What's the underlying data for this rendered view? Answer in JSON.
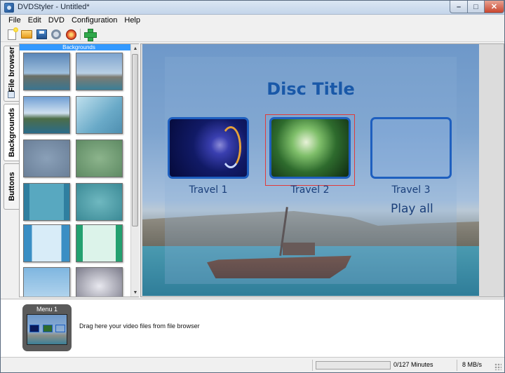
{
  "window": {
    "title": "DVDStyler - Untitled*"
  },
  "menubar": [
    "File",
    "Edit",
    "DVD",
    "Configuration",
    "Help"
  ],
  "toolbar": {
    "icons": [
      "new-icon",
      "open-icon",
      "save-icon",
      "settings-icon",
      "burn-icon",
      "add-file-icon"
    ]
  },
  "side_tabs": {
    "file_browser": "File browser",
    "backgrounds": "Backgrounds",
    "buttons": "Buttons"
  },
  "backgrounds_panel": {
    "header": "Backgrounds",
    "thumbnail_count": 12
  },
  "menu_preview": {
    "title": "Disc Title",
    "buttons": [
      {
        "label": "Travel 1"
      },
      {
        "label": "Travel 2"
      },
      {
        "label": "Travel 3"
      }
    ],
    "play_all": "Play all",
    "selection_color": "#e03a3a",
    "button_border_color": "#1e5fbf"
  },
  "titleset": {
    "menu_label": "Menu 1",
    "drag_hint": "Drag here your video files from file browser"
  },
  "status": {
    "duration": "0/127 Minutes",
    "rate": "8 MB/s",
    "progress_fraction": 0.0
  }
}
